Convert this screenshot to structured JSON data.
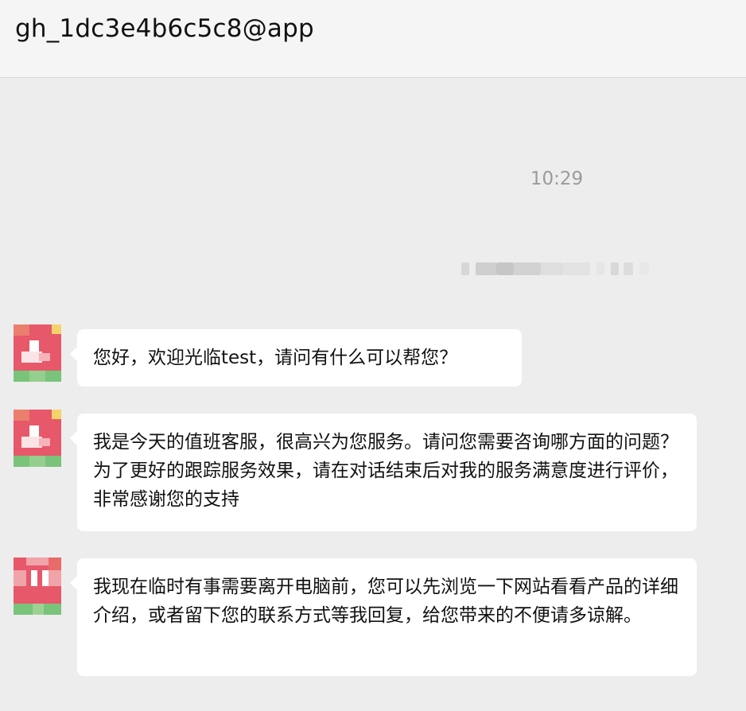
{
  "header": {
    "title": "gh_1dc3e4b6c5c8@app"
  },
  "chat": {
    "timestamp": "10:29",
    "messages": [
      {
        "text": "您好，欢迎光临test，请问有什么可以帮您？"
      },
      {
        "text": "我是今天的值班客服，很高兴为您服务。请问您需要咨询哪方面的问题？为了更好的跟踪服务效果，请在对话结束后对我的服务满意度进行评价，非常感谢您的支持"
      },
      {
        "text": "我现在临时有事需要离开电脑前，您可以先浏览一下网站看看产品的详细介绍，或者留下您的联系方式等我回复，给您带来的不便请多谅解。"
      }
    ]
  },
  "colors": {
    "background": "#ededed",
    "header_bg": "#f5f5f5",
    "bubble_bg": "#ffffff",
    "timestamp": "#9b9b9b",
    "avatar_red": "#e94b5c",
    "avatar_green": "#79c37b",
    "avatar_yellow": "#f5d36a"
  },
  "icons": {
    "avatar": "pixelated-avatar-icon",
    "system_notice": "blurred-system-notice"
  }
}
